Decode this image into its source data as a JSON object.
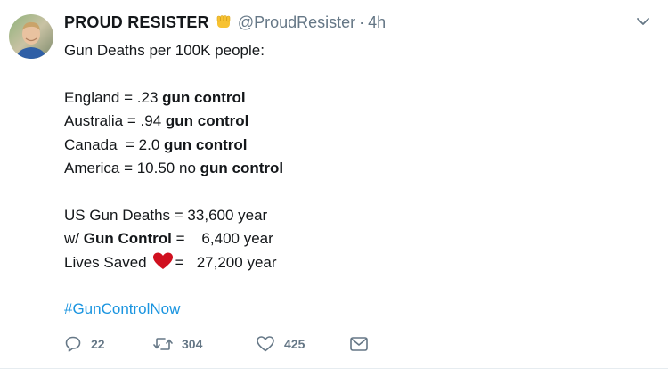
{
  "tweet": {
    "display_name": "PROUD RESISTER",
    "handle": "@ProudResister",
    "separator": "·",
    "time": "4h",
    "emoji_icon": "raised-fist-emoji",
    "menu_icon": "chevron-down-icon",
    "lines": [
      "Gun Deaths per 100K people:",
      "",
      "England = .23 ",
      "gun control",
      "Australia = .94 ",
      "gun control",
      "Canada  = 2.0 ",
      "gun control",
      "America = 10.50 no ",
      "gun control",
      "",
      "US Gun Deaths = 33,600 year",
      "w/ ",
      "Gun Control",
      " =    6,400 year",
      "Lives Saved",
      "=   27,200 year",
      "",
      "#GunControlNow"
    ],
    "heart_icon": "red-heart-emoji",
    "hashtag_color": "#1b95e0",
    "actions": {
      "reply_count": "22",
      "retweet_count": "304",
      "like_count": "425",
      "reply_icon": "reply-icon",
      "retweet_icon": "retweet-icon",
      "like_icon": "heart-outline-icon",
      "dm_icon": "envelope-icon"
    }
  }
}
